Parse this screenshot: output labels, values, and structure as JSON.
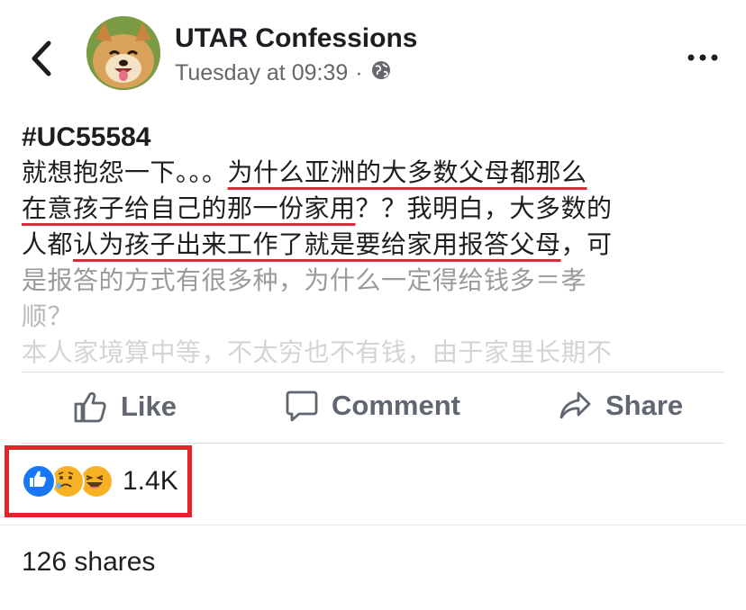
{
  "header": {
    "page_name": "UTAR Confessions",
    "timestamp": "Tuesday at 09:39",
    "separator": "·"
  },
  "post": {
    "tag": "#UC55584",
    "lines": [
      "就想抱怨一下。。。为什么亚洲的大多数父母都那么",
      "在意孩子给自己的那一份家用？？我明白，大多数的",
      "人都认为孩子出来工作了就是要给家用报答父母，可",
      "是报答的方式有很多种，为什么一定得给钱多＝孝",
      "顺？",
      "本人家境算中等，不太穷也不有钱，由于家里长期不"
    ],
    "line1_plain": "就想抱怨一下。。。",
    "line1_ul": "为什么亚洲的大多数父母都那么",
    "line2_ul": "在意孩子给自己的那一份家用",
    "line2_plain": "？？我明白，大多数的",
    "line3_a": "人都",
    "line3_ul": "认为孩子出来工作了就是要给家用报答父母",
    "line3_b": "，可"
  },
  "actions": {
    "like": "Like",
    "comment": "Comment",
    "share": "Share"
  },
  "reactions": {
    "types": [
      "like",
      "sad",
      "haha"
    ],
    "count": "1.4K",
    "highlight_color": "#e5232d"
  },
  "shares": {
    "label": "126 shares"
  },
  "colors": {
    "underline": "#d62f3c",
    "text": "#1c1e21",
    "secondary": "#65676b",
    "like_blue": "#1877f2"
  }
}
